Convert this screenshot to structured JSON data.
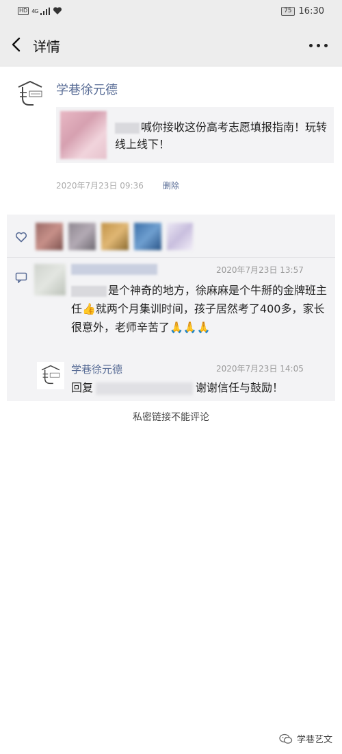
{
  "status": {
    "hd": "HD",
    "network": "4G",
    "battery": "75",
    "time": "16:30"
  },
  "nav": {
    "title": "详情"
  },
  "post": {
    "author": "学巷徐元德",
    "link_text": "喊你接收这份高考志愿填报指南！玩转线上线下！",
    "time": "2020年7月23日 09:36",
    "delete_label": "删除"
  },
  "comment": {
    "time": "2020年7月23日 13:57",
    "text": "是个神奇的地方，徐麻麻是个牛掰的金牌班主任👍就两个月集训时间，孩子居然考了400多，家长很意外，老师辛苦了🙏🙏🙏"
  },
  "reply": {
    "author": "学巷徐元德",
    "time": "2020年7月23日 14:05",
    "prefix": "回复",
    "text": "谢谢信任与鼓励！"
  },
  "private_note": "私密链接不能评论",
  "watermark": "学巷艺文",
  "colors": {
    "link_blue": "#576b95",
    "panel_bg": "#f3f3f5",
    "bar_bg": "#ededed"
  }
}
